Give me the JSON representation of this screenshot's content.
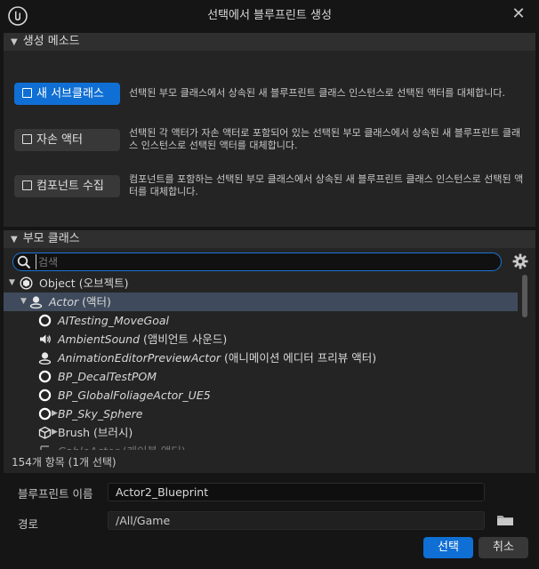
{
  "window": {
    "title": "선택에서 블루프린트 생성",
    "close_symbol": "✕"
  },
  "creation_method": {
    "header": "생성 메소드",
    "options": [
      {
        "label": "새 서브클래스",
        "icon": "subclass-icon",
        "active": true,
        "desc": "선택된 부모 클래스에서 상속된 새 블루프린트 클래스 인스턴스로 선택된 액터를 대체합니다."
      },
      {
        "label": "자손 액터",
        "icon": "child-actor-icon",
        "active": false,
        "desc": "선택된 각 액터가 자손 액터로 포함되어 있는 선택된 부모 클래스에서 상속된 새 블루프린트 클래스 인스턴스로 선택된 액터를 대체합니다."
      },
      {
        "label": "컴포넌트 수집",
        "icon": "component-icon",
        "active": false,
        "desc": "컴포넌트를 포함하는 선택된 부모 클래스에서 상속된 새 블루프린트 클래스 인스턴스로 선택된 액터를 대체합니다."
      }
    ]
  },
  "parent_class": {
    "header": "부모 클래스",
    "search_placeholder": "검색",
    "status": "154개 항목 (1개 선택)",
    "tree": [
      {
        "name": "Object",
        "suffix": " (오브젝트)",
        "italic": false,
        "indent": 0,
        "expander": "▼",
        "icon": "object-icon",
        "selected": false
      },
      {
        "name": "Actor",
        "suffix": " (액터)",
        "italic": true,
        "indent": 1,
        "expander": "▼",
        "icon": "actor-icon",
        "selected": true
      },
      {
        "name": "AITesting_MoveGoal",
        "suffix": "",
        "italic": true,
        "indent": 2,
        "expander": "",
        "icon": "circle-icon",
        "selected": false
      },
      {
        "name": "AmbientSound",
        "suffix": " (앰비언트 사운드)",
        "italic": true,
        "indent": 2,
        "expander": "",
        "icon": "speaker-icon",
        "selected": false
      },
      {
        "name": "AnimationEditorPreviewActor",
        "suffix": " (애니메이션 에디터 프리뷰 액터)",
        "italic": true,
        "indent": 2,
        "expander": "",
        "icon": "actor-icon",
        "selected": false
      },
      {
        "name": "BP_DecalTestPOM",
        "suffix": "",
        "italic": true,
        "indent": 2,
        "expander": "",
        "icon": "circle-icon",
        "selected": false
      },
      {
        "name": "BP_GlobalFoliageActor_UE5",
        "suffix": "",
        "italic": true,
        "indent": 2,
        "expander": "",
        "icon": "circle-icon",
        "selected": false
      },
      {
        "name": "BP_Sky_Sphere",
        "suffix": "",
        "italic": true,
        "indent": 2,
        "expander": "▶",
        "icon": "circle-icon",
        "selected": false
      },
      {
        "name": "Brush",
        "suffix": " (브러시)",
        "italic": false,
        "indent": 2,
        "expander": "▶",
        "icon": "cube-icon",
        "selected": false
      },
      {
        "name": "CableActor",
        "suffix": " (케이블 액터)",
        "italic": true,
        "indent": 2,
        "expander": "",
        "icon": "cable-icon",
        "selected": false,
        "faded": true
      }
    ]
  },
  "form": {
    "name_label": "블루프린트 이름",
    "name_value": "Actor2_Blueprint",
    "path_label": "경로",
    "path_value": "/All/Game"
  },
  "buttons": {
    "select": "선택",
    "cancel": "취소"
  },
  "colors": {
    "accent": "#0f6fd4",
    "selection": "#3f4b5c",
    "panel": "#242424",
    "background": "#151515"
  }
}
